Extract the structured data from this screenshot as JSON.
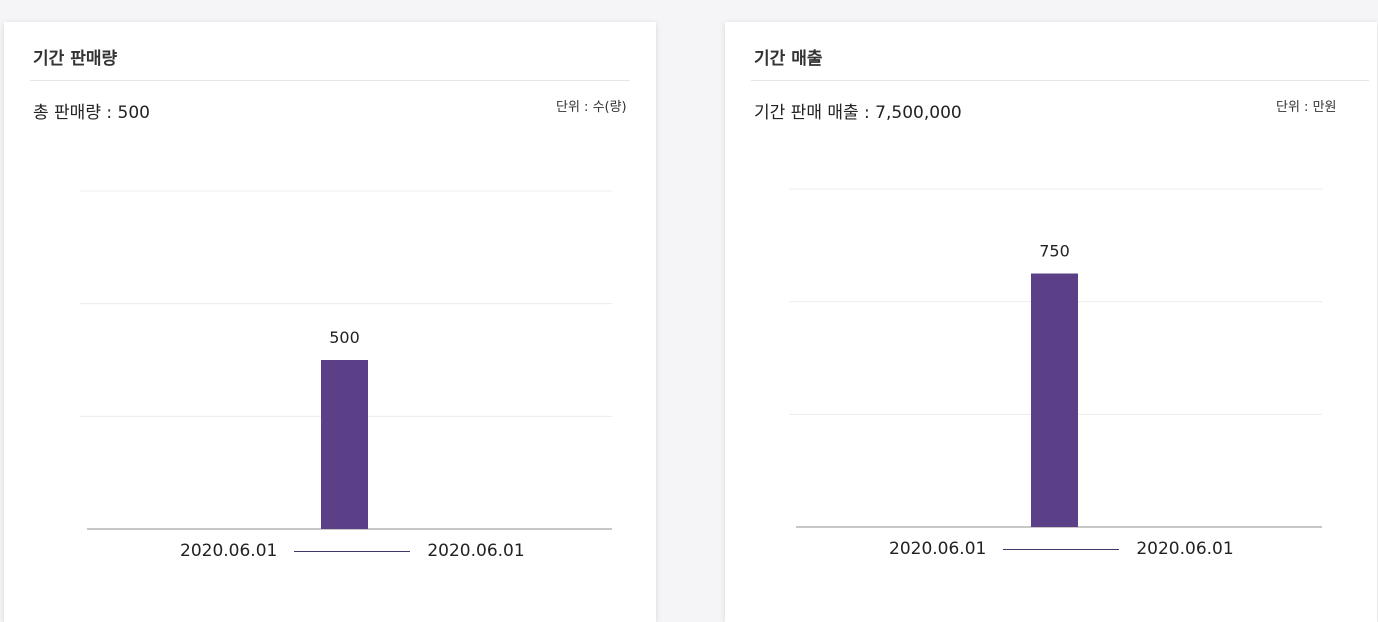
{
  "panels": [
    {
      "title": "기간 판매량",
      "summary": "총 판매량 : 500",
      "unit": "단위 : 수(량)",
      "range_start": "2020.06.01",
      "range_end": "2020.06.01"
    },
    {
      "title": "기간 매출",
      "summary": "기간 판매 매출 : 7,500,000",
      "unit": "단위 : 만원",
      "range_start": "2020.06.01",
      "range_end": "2020.06.01"
    }
  ],
  "colors": {
    "bar": "#5b3f87",
    "grid": "#ececec",
    "axis": "#b5b5b5"
  },
  "chart_data": [
    {
      "type": "bar",
      "categories": [
        ""
      ],
      "values": [
        500
      ],
      "data_labels": [
        "500"
      ],
      "ylim": [
        0,
        1000
      ],
      "grid": true
    },
    {
      "type": "bar",
      "categories": [
        ""
      ],
      "values": [
        750
      ],
      "data_labels": [
        "750"
      ],
      "ylim": [
        0,
        1000
      ],
      "grid": true
    }
  ]
}
